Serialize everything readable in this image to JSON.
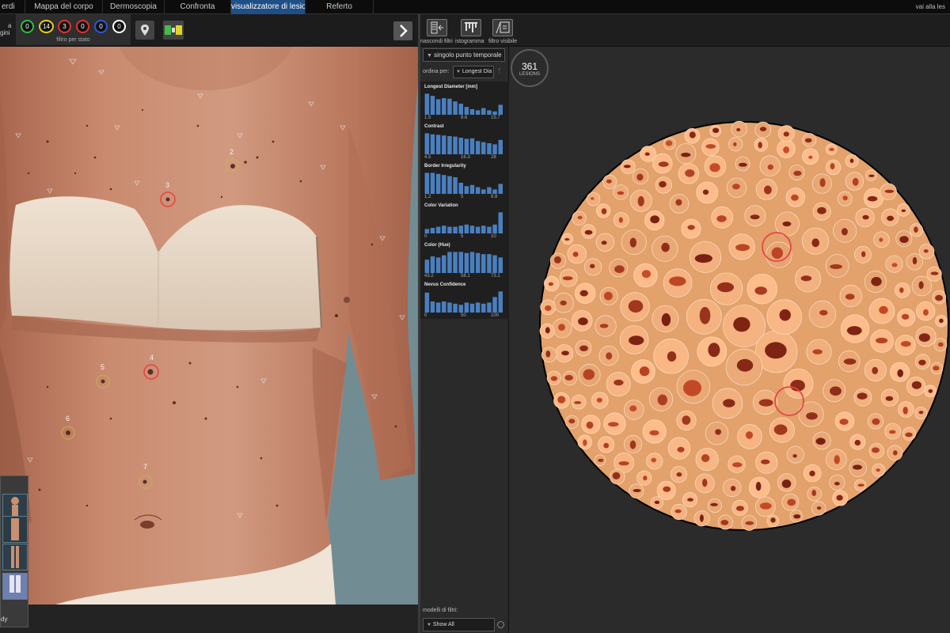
{
  "tabs": [
    {
      "label": "erdi",
      "active": false
    },
    {
      "label": "Mappa del corpo",
      "active": false
    },
    {
      "label": "Dermoscopia",
      "active": false
    },
    {
      "label": "Confronta",
      "active": false
    },
    {
      "label": "visualizzatore di lesioni",
      "active": true
    },
    {
      "label": "Referto",
      "active": false
    }
  ],
  "goto_link": "vai alla les",
  "left_toolbar": {
    "partial_label_1": "a",
    "partial_label_2": "gini",
    "status_filter": {
      "label": "filtro per stato",
      "rings": [
        {
          "value": "0",
          "color": "#29c23a"
        },
        {
          "value": "14",
          "color": "#e8d21b"
        },
        {
          "value": "3",
          "color": "#e33030"
        },
        {
          "value": "0",
          "color": "#e33030"
        },
        {
          "value": "0",
          "color": "#2d56e0"
        },
        {
          "value": "0",
          "color": "#ffffff"
        }
      ]
    },
    "next_icon": "chevron-right-icon"
  },
  "lesion_markers": [
    "2",
    "3",
    "4",
    "5",
    "6",
    "7"
  ],
  "view_strip_label": "dy",
  "right_toolbar": {
    "hide_filters": "nascondi filtri",
    "histogram": "istogramma",
    "visible_filter": "filtro visibile"
  },
  "filters": {
    "time_select": "singolo punto temporale",
    "sort_label": "ordina per:",
    "sort_value": "Longest Dia",
    "histograms": [
      {
        "title": "Longest Diameter [mm]",
        "ticks": [
          "1.5",
          "8.6",
          "15.7"
        ],
        "bars": [
          0.95,
          0.85,
          0.7,
          0.75,
          0.72,
          0.6,
          0.5,
          0.35,
          0.25,
          0.2,
          0.3,
          0.2,
          0.15,
          0.45
        ]
      },
      {
        "title": "Contrast",
        "ticks": [
          "4.5",
          "16.3",
          "28"
        ],
        "bars": [
          0.95,
          0.9,
          0.88,
          0.85,
          0.82,
          0.8,
          0.75,
          0.7,
          0.72,
          0.6,
          0.55,
          0.5,
          0.45,
          0.65
        ]
      },
      {
        "title": "Border Irregularity",
        "ticks": [
          "1.2",
          "5",
          "8.8"
        ],
        "bars": [
          0.95,
          0.95,
          0.9,
          0.85,
          0.8,
          0.75,
          0.5,
          0.35,
          0.4,
          0.3,
          0.2,
          0.3,
          0.2,
          0.45
        ]
      },
      {
        "title": "Color Variation",
        "ticks": [
          "0",
          "5",
          "10"
        ],
        "bars": [
          0.2,
          0.25,
          0.3,
          0.35,
          0.3,
          0.3,
          0.35,
          0.4,
          0.35,
          0.3,
          0.35,
          0.3,
          0.4,
          0.95
        ]
      },
      {
        "title": "Color (Hue)",
        "ticks": [
          "43.2",
          "58.1",
          "73.1"
        ],
        "bars": [
          0.6,
          0.75,
          0.7,
          0.8,
          0.95,
          0.95,
          0.95,
          0.9,
          0.95,
          0.9,
          0.85,
          0.85,
          0.8,
          0.7
        ]
      },
      {
        "title": "Nevus Confidence",
        "ticks": [
          "0",
          "50",
          "100"
        ],
        "bars": [
          0.9,
          0.5,
          0.45,
          0.5,
          0.45,
          0.4,
          0.35,
          0.45,
          0.4,
          0.45,
          0.4,
          0.45,
          0.7,
          0.95
        ]
      }
    ],
    "models_label": "modelli di filtri:",
    "models_value": "Show All"
  },
  "viewer": {
    "count": "361",
    "count_label": "LESIONS"
  },
  "colors": {
    "active_tab": "#1f4f86",
    "histogram_bar": "#4a7fbf",
    "disc_background": "#f0ac75",
    "selection_ring": "#e84545"
  }
}
